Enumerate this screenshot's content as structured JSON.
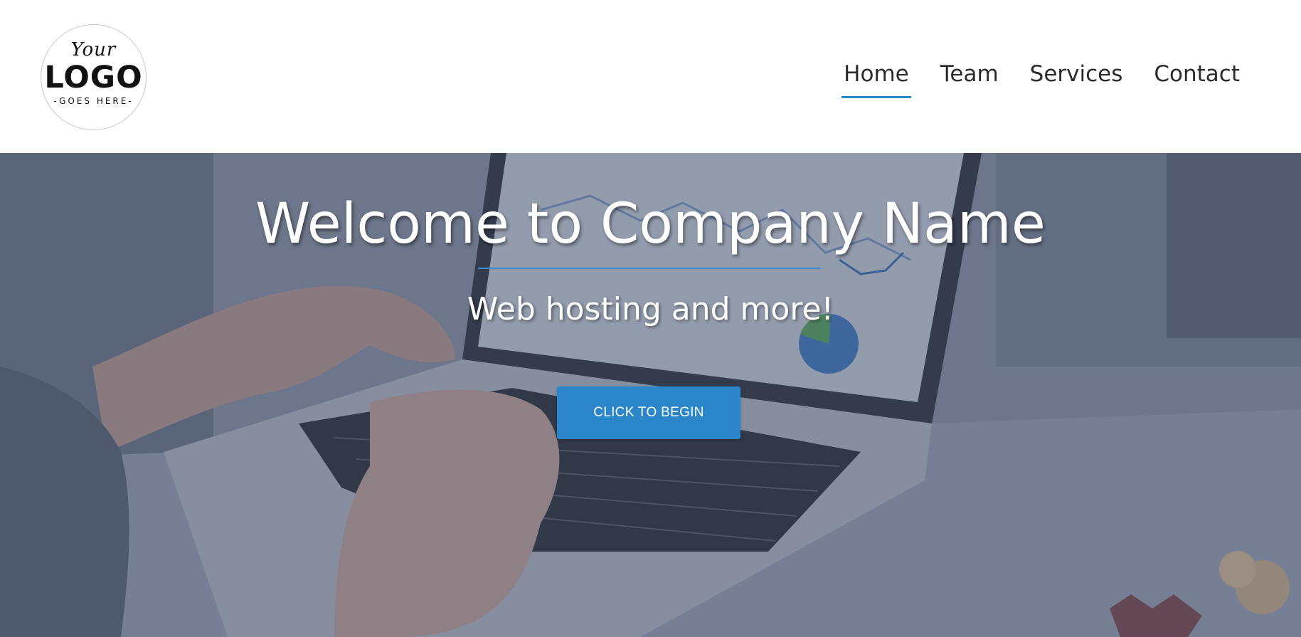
{
  "logo": {
    "top_text": "Your",
    "main_text": "LOGO",
    "bottom_text": "-GOES HERE-"
  },
  "nav": {
    "items": [
      {
        "label": "Home",
        "active": true
      },
      {
        "label": "Team",
        "active": false
      },
      {
        "label": "Services",
        "active": false
      },
      {
        "label": "Contact",
        "active": false
      }
    ]
  },
  "hero": {
    "title": "Welcome to Company Name",
    "subtitle": "Web hosting and more!",
    "button_label": "CLICK TO BEGIN",
    "background_image": "laptop-typing-photo"
  },
  "colors": {
    "accent": "#2a86c9",
    "nav_text": "#2b2b2b",
    "hero_text": "#ffffff",
    "overlay": "#3c4864"
  }
}
